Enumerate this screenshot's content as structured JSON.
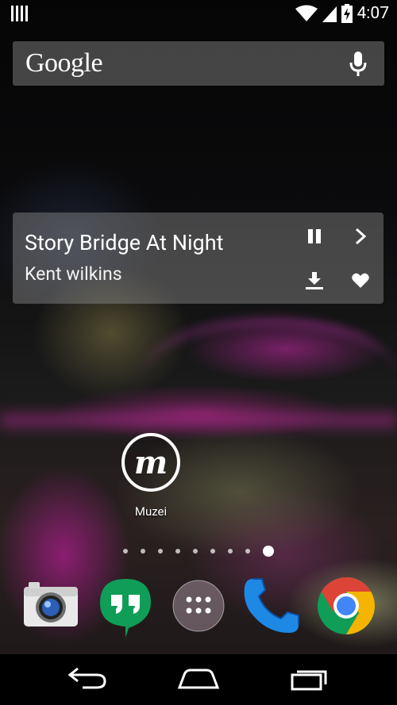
{
  "status_bar": {
    "time": "4:07",
    "icons": [
      "signal-bars-icon",
      "wifi-icon",
      "cell-signal-icon",
      "battery-charging-icon"
    ]
  },
  "search_bar": {
    "logo_text": "Google",
    "mic_icon": "mic-icon"
  },
  "muzei_widget": {
    "title": "Story Bridge At Night",
    "author": "Kent wilkins",
    "buttons": [
      "pause-icon",
      "next-icon",
      "download-icon",
      "favorite-heart-icon"
    ]
  },
  "home_apps": [
    {
      "label": "Muzei",
      "icon": "muzei-icon",
      "glyph": "m"
    }
  ],
  "page_indicator": {
    "pages": 9,
    "current": 9
  },
  "dock": [
    {
      "name": "camera",
      "icon": "camera-icon"
    },
    {
      "name": "hangouts",
      "icon": "hangouts-icon"
    },
    {
      "name": "all-apps",
      "icon": "all-apps-icon"
    },
    {
      "name": "phone",
      "icon": "phone-icon"
    },
    {
      "name": "chrome",
      "icon": "chrome-icon"
    }
  ],
  "nav_bar": [
    "back-icon",
    "home-icon",
    "recents-icon"
  ],
  "colors": {
    "hangouts_green": "#0F9D58",
    "phone_blue": "#1E88E5",
    "chrome_red": "#DB4437",
    "chrome_yellow": "#F4B400",
    "chrome_green": "#0F9D58",
    "chrome_blue": "#4285F4"
  }
}
